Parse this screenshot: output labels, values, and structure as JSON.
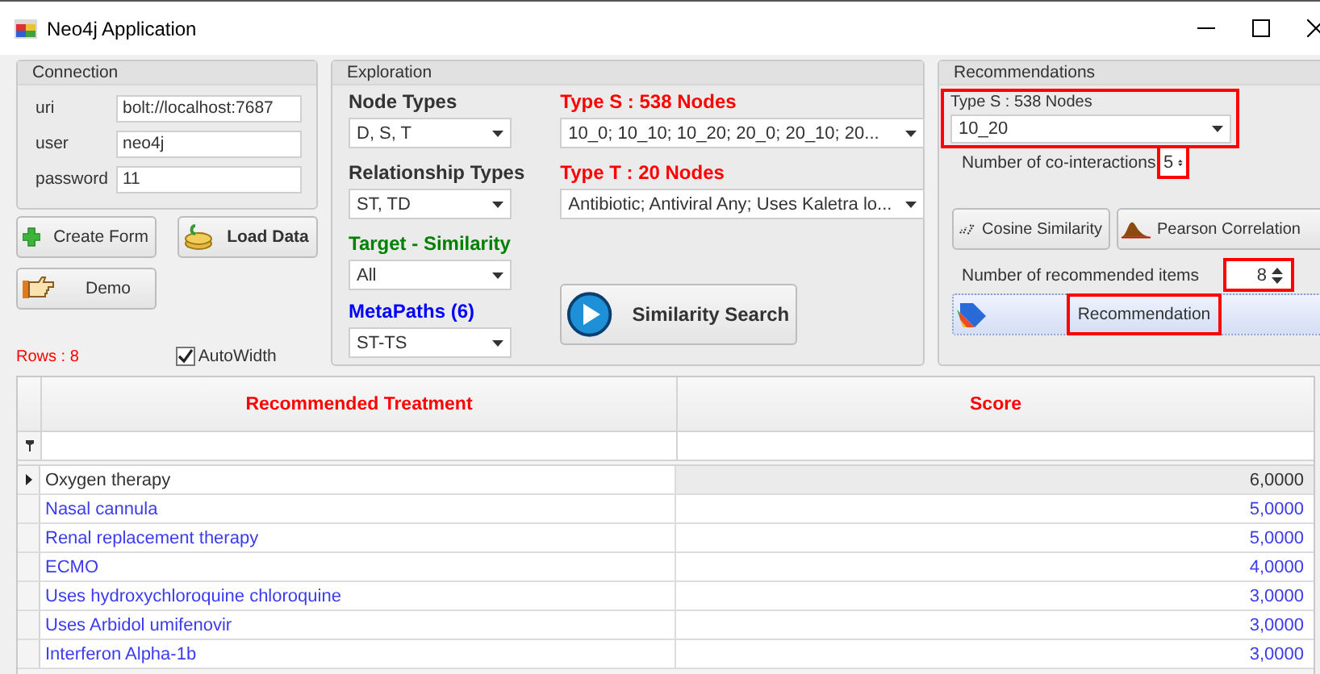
{
  "window": {
    "title": "Neo4j Application"
  },
  "connection": {
    "title": "Connection",
    "fields": [
      {
        "label": "uri",
        "value": "bolt://localhost:7687"
      },
      {
        "label": "user",
        "value": "neo4j"
      },
      {
        "label": "password",
        "value": "11"
      }
    ]
  },
  "buttons": [
    {
      "label": "Create Form",
      "kind": "add"
    },
    {
      "label": "Load Data",
      "kind": "load"
    },
    {
      "label": "Demo",
      "kind": "demo"
    }
  ],
  "rows_count": "Rows : 8",
  "autowidth": {
    "label": "AutoWidth",
    "checked": true
  },
  "exploration": {
    "title": "Exploration",
    "selectors": [
      {
        "label": "Node Types",
        "color": "#333333",
        "value": "D, S, T"
      },
      {
        "label": "Relationship Types",
        "color": "#333333",
        "value": "ST, TD"
      },
      {
        "label": "Target - Similarity",
        "color": "#008000",
        "value": "All"
      },
      {
        "label": "MetaPaths (6)",
        "color": "#0000ff",
        "value": "ST-TS"
      }
    ],
    "node_lists": [
      {
        "label": "Type S : 538 Nodes",
        "value": "10_0; 10_10; 10_20; 20_0; 20_10; 20..."
      },
      {
        "label": "Type T : 20 Nodes",
        "value": "Antibiotic; Antiviral Any; Uses Kaletra lo..."
      }
    ],
    "search_button": "Similarity Search"
  },
  "recommendations": {
    "title": "Recommendations",
    "type_s": {
      "label": "Type S : 538 Nodes",
      "value": "10_20",
      "highlighted": true
    },
    "co_interactions": {
      "label": "Number of co-interactions",
      "value": "5",
      "highlighted": true
    },
    "methods": [
      {
        "label": "Cosine Similarity",
        "kind": "cosine"
      },
      {
        "label": "Pearson Correlation",
        "kind": "pearson"
      }
    ],
    "recommended_items": {
      "label": "Number of recommended items",
      "value": "8",
      "highlighted": true
    },
    "recommendation_button": {
      "label": "Recommendation",
      "highlighted": true
    }
  },
  "table": {
    "columns": [
      "Recommended Treatment",
      "Score"
    ],
    "rows": [
      {
        "treatment": "Oxygen therapy",
        "score": "6,0000",
        "selected": true
      },
      {
        "treatment": "Nasal cannula",
        "score": "5,0000",
        "selected": false
      },
      {
        "treatment": "Renal replacement therapy",
        "score": "5,0000",
        "selected": false
      },
      {
        "treatment": "ECMO",
        "score": "4,0000",
        "selected": false
      },
      {
        "treatment": "Uses hydroxychloroquine chloroquine",
        "score": "3,0000",
        "selected": false
      },
      {
        "treatment": "Uses Arbidol umifenovir",
        "score": "3,0000",
        "selected": false
      },
      {
        "treatment": "Interferon Alpha-1b",
        "score": "3,0000",
        "selected": false
      }
    ]
  }
}
